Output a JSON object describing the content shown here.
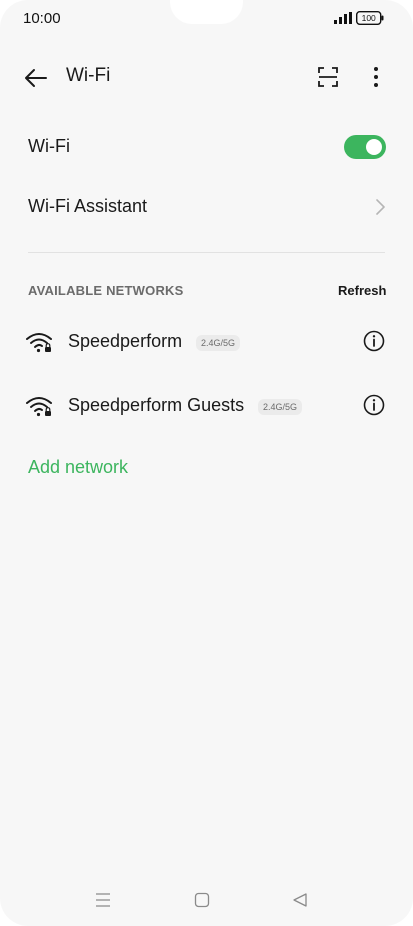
{
  "status_bar": {
    "time": "10:00",
    "battery": "100"
  },
  "header": {
    "title": "Wi-Fi"
  },
  "settings": {
    "wifi_label": "Wi-Fi",
    "wifi_enabled": true,
    "assistant_label": "Wi-Fi Assistant"
  },
  "networks_section": {
    "header": "AVAILABLE NETWORKS",
    "refresh_label": "Refresh",
    "items": [
      {
        "name": "Speedperform",
        "band": "2.4G/5G"
      },
      {
        "name": "Speedperform Guests",
        "band": "2.4G/5G"
      }
    ],
    "add_label": "Add network"
  },
  "colors": {
    "accent": "#3cb55e",
    "background": "#f7f7f7"
  },
  "icons": [
    "back-arrow-icon",
    "scan-qr-icon",
    "more-vert-icon",
    "chevron-right-icon",
    "wifi-lock-icon",
    "info-icon",
    "menu-icon",
    "home-square-icon",
    "back-triangle-icon"
  ]
}
